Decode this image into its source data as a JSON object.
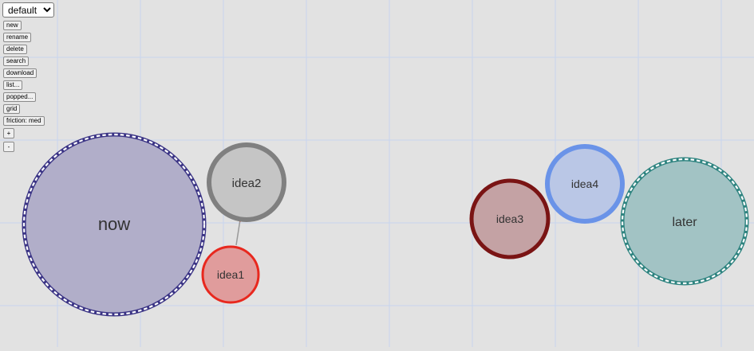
{
  "toolbar": {
    "board_select": {
      "selected": "default",
      "options": [
        "default"
      ]
    },
    "buttons": {
      "new": "new",
      "rename": "rename",
      "delete": "delete",
      "search": "search",
      "download": "download",
      "list": "list...",
      "popped": "popped...",
      "grid": "grid",
      "friction": "friction: med",
      "zoom_in": "+",
      "zoom_out": "-"
    }
  },
  "bubbles": {
    "now": {
      "label": "now",
      "fill": "#b1aec9",
      "border": "#3b3485",
      "style": "dashed-ring"
    },
    "idea2": {
      "label": "idea2",
      "fill": "#c5c5c5",
      "border": "#808080",
      "style": "solid"
    },
    "idea1": {
      "label": "idea1",
      "fill": "#e09c9c",
      "border": "#e8281e",
      "style": "solid"
    },
    "idea3": {
      "label": "idea3",
      "fill": "#c4a2a4",
      "border": "#7a1414",
      "style": "solid"
    },
    "idea4": {
      "label": "idea4",
      "fill": "#bac7e6",
      "border": "#6a93e8",
      "style": "solid"
    },
    "later": {
      "label": "later",
      "fill": "#a2c3c4",
      "border": "#2f8480",
      "style": "dashed-ring"
    }
  },
  "links": [
    {
      "from": "idea1",
      "to": "idea2",
      "color": "#999999",
      "arrow_color": "#e8281e"
    }
  ],
  "grid": {
    "visible": true,
    "color": "#c8d4ef"
  }
}
